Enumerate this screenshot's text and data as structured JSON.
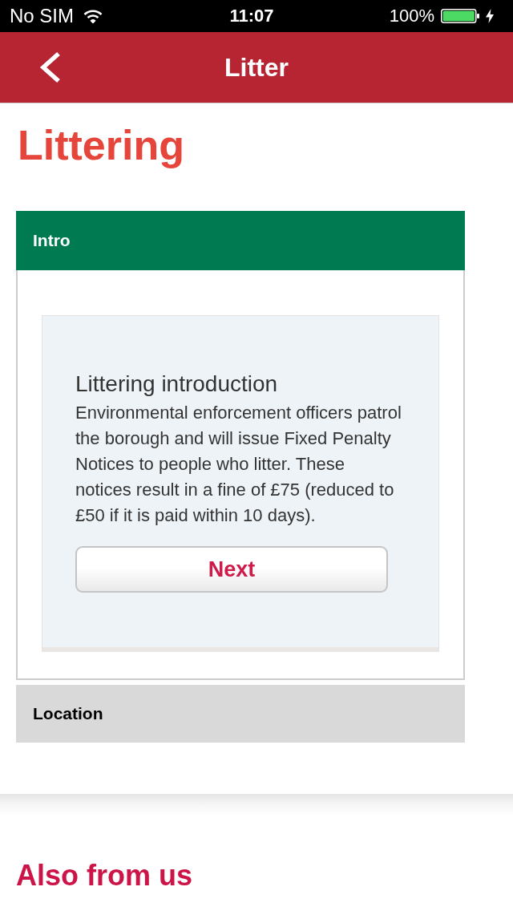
{
  "status_bar": {
    "carrier": "No SIM",
    "time": "11:07",
    "battery": "100%"
  },
  "nav_bar": {
    "title": "Litter"
  },
  "page_title": "Littering",
  "sections": [
    {
      "label": "Intro",
      "expanded": true,
      "card": {
        "title": "Littering introduction",
        "body": "Environmental enforcement officers patrol the borough and will issue Fixed Penalty Notices to people who litter. These notices result in a fine of £75 (reduced to £50 if it is paid within 10 days).",
        "button": "Next"
      }
    },
    {
      "label": "Location",
      "expanded": false
    }
  ],
  "also_heading": "Also from us"
}
